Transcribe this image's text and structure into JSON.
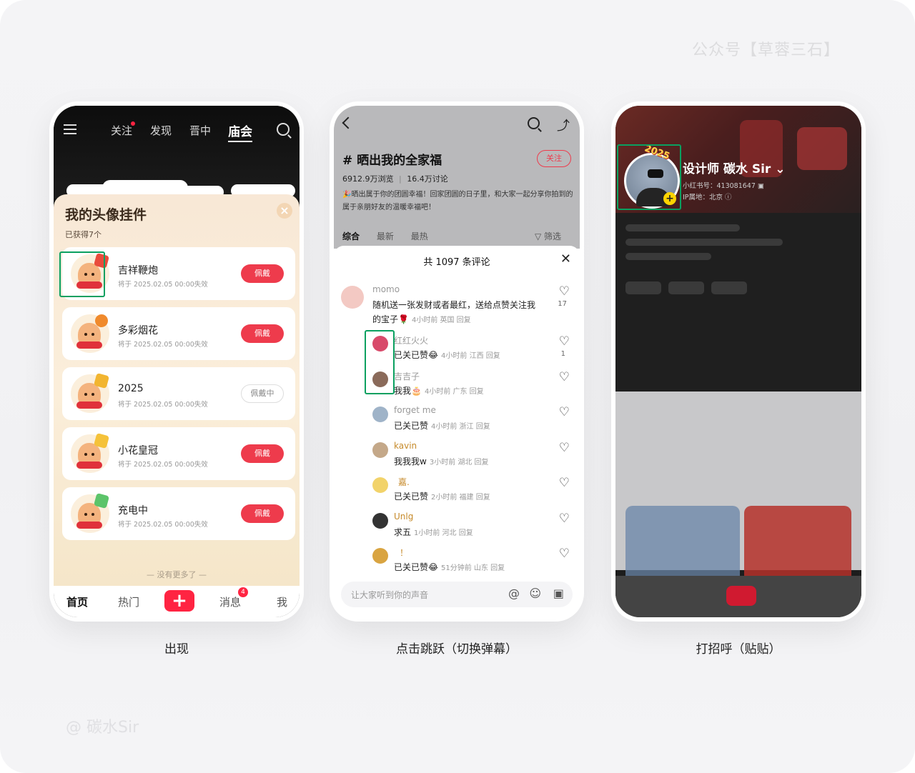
{
  "watermark_top": "公众号【草蓉三石】",
  "watermark_bottom": "@ 碳水Sir",
  "captions": [
    "出现",
    "点击跳跃（切换弹幕）",
    "打招呼（贴贴）"
  ],
  "phone1": {
    "nav": {
      "follow": "关注",
      "discover": "发现",
      "local": "晋中",
      "active": "庙会"
    },
    "sheet": {
      "title": "我的头像挂件",
      "subtitle": "已获得7个"
    },
    "pendants": [
      {
        "name": "吉祥鞭炮",
        "expiry": "将于 2025.02.05 00:00失效",
        "button": "佩戴",
        "deco_color": "#e94b3c"
      },
      {
        "name": "多彩烟花",
        "expiry": "将于 2025.02.05 00:00失效",
        "button": "佩戴",
        "deco_color": "#f08a2c"
      },
      {
        "name": "2025",
        "expiry": "将于 2025.02.05 00:00失效",
        "button": "佩戴中",
        "deco_color": "#f2b530"
      },
      {
        "name": "小花皇冠",
        "expiry": "将于 2025.02.05 00:00失效",
        "button": "佩戴",
        "deco_color": "#f5c23a"
      },
      {
        "name": "充电中",
        "expiry": "将于 2025.02.05 00:00失效",
        "button": "佩戴",
        "deco_color": "#5cc46a"
      }
    ],
    "no_more": "— 没有更多了 —",
    "tabbar": {
      "home": "首页",
      "hot": "热门",
      "plus": "+",
      "messages": "消息",
      "badge": "4",
      "me": "我"
    }
  },
  "phone2": {
    "topic_title": "# 晒出我的全家福",
    "follow": "关注",
    "views": "6912.9万浏览",
    "discussions": "16.4万讨论",
    "description": "🎉晒出属于你的团圆幸福！回家团圆的日子里，和大家一起分享你拍到的属于亲朋好友的温暖幸福吧！",
    "tabs": [
      "综合",
      "最新",
      "最热"
    ],
    "filter": "▽ 筛选",
    "comment_count": "共 1097 条评论",
    "close": "✕",
    "comments": [
      {
        "nick": "momo",
        "text_line1": "随机送一张发财或者最红，送给点赞关注我",
        "text_line2": "的宝子🌹",
        "meta": "4小时前 英国 回复",
        "likes": "17",
        "avatar_color": "#f3c9c3"
      },
      {
        "nick": "红红火火",
        "text": "已关已赞😂",
        "meta": "4小时前 江西 回复",
        "likes": "1",
        "avatar_color": "#d84a6a"
      },
      {
        "nick": "吉吉子",
        "text": "我我🎂",
        "meta": "4小时前 广东 回复",
        "likes": "",
        "avatar_color": "#8a6a5a"
      },
      {
        "nick": "forget me",
        "text": "已关已赞",
        "meta": "4小时前 浙江 回复",
        "likes": "",
        "avatar_color": "#9fb3c8"
      },
      {
        "nick": "kavin",
        "text": "我我我w",
        "meta": "3小时前 湖北 回复",
        "likes": "",
        "avatar_color": "#c4a889"
      },
      {
        "nick": "嘉.",
        "text": "已关已赞",
        "meta": "2小时前 福建 回复",
        "likes": "",
        "avatar_color": "#f2d36a"
      },
      {
        "nick": "Unlg",
        "text": "求五",
        "meta": "1小时前 河北 回复",
        "likes": "",
        "avatar_color": "#333333"
      },
      {
        "nick": "！",
        "text": "已关已赞😂",
        "meta": "51分钟前 山东 回复",
        "likes": "",
        "avatar_color": "#d9a441"
      }
    ],
    "input_placeholder": "让大家听到你的声音"
  },
  "phone3": {
    "name": "设计师 碳水 Sir ⌄",
    "xhs_id": "小红书号：413081647 ▣",
    "ip": "IP属地：北京 ⓘ",
    "stamp": "2025"
  },
  "highlight_color": "#0aa060"
}
